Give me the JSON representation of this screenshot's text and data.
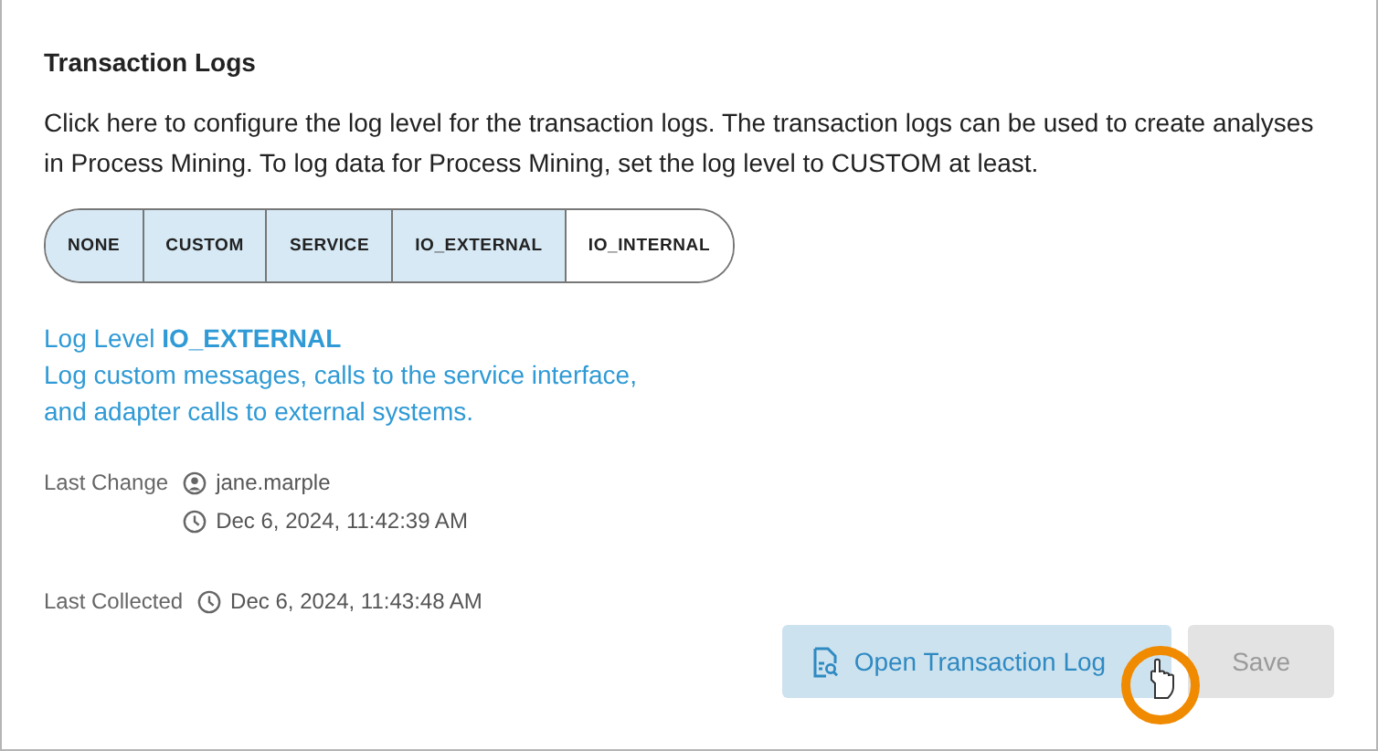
{
  "section": {
    "title": "Transaction Logs",
    "description": "Click here to configure the log level for the transaction logs. The transaction logs can be used to create analyses in Process Mining. To log data for Process Mining, set the log level to CUSTOM at least."
  },
  "levels": [
    {
      "label": "NONE",
      "filled": true
    },
    {
      "label": "CUSTOM",
      "filled": true
    },
    {
      "label": "SERVICE",
      "filled": true
    },
    {
      "label": "IO_EXTERNAL",
      "filled": true
    },
    {
      "label": "IO_INTERNAL",
      "filled": false
    }
  ],
  "level_info": {
    "heading": "Log Level **IO_EXTERNAL**",
    "text": "Log custom messages, calls to the service interface, and adapter calls to external systems."
  },
  "last_change": {
    "label": "Last Change",
    "user": "jane.marple",
    "time": "Dec 6, 2024, 11:42:39 AM"
  },
  "last_collected": {
    "label": "Last Collected",
    "time": "Dec 6, 2024, 11:43:48 AM"
  },
  "buttons": [
    {
      "label": "Open Transaction Log",
      "disabled": false
    },
    {
      "label": "Save",
      "disabled": true
    }
  ]
}
